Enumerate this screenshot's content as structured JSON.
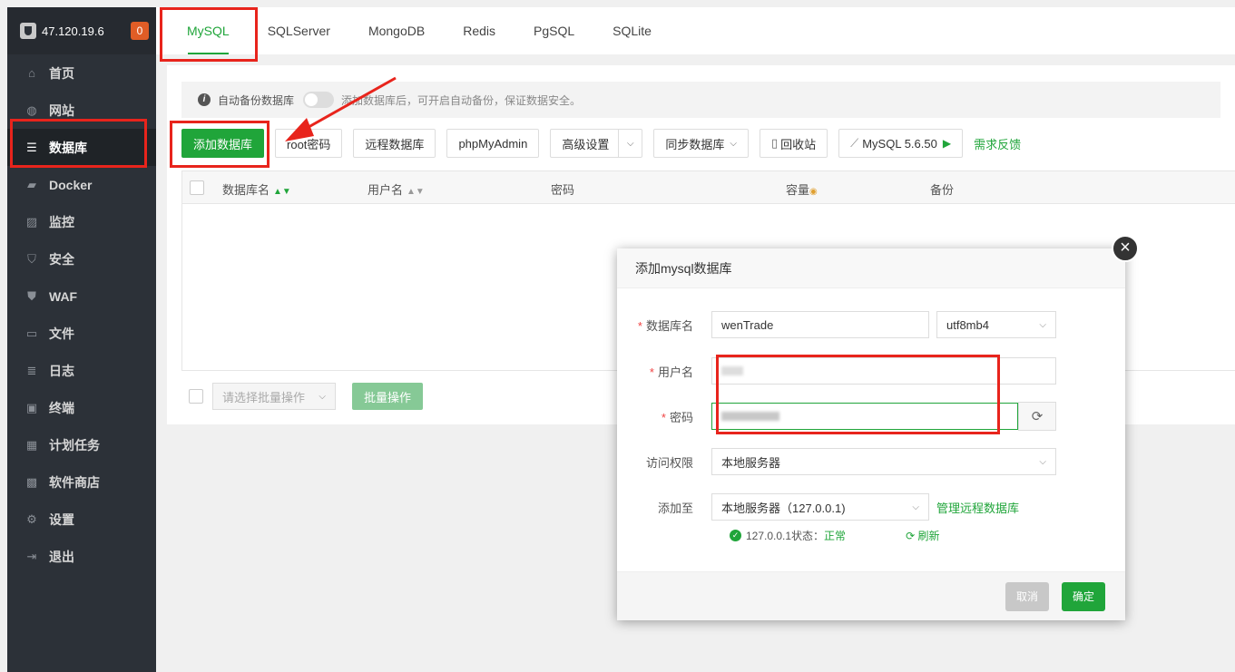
{
  "sidebar": {
    "server_ip": "47.120.19.6",
    "badge": "0",
    "items": [
      {
        "label": "首页",
        "icon": "home-icon",
        "glyph": "⌂"
      },
      {
        "label": "网站",
        "icon": "globe-icon",
        "glyph": "◍"
      },
      {
        "label": "数据库",
        "icon": "database-icon",
        "glyph": "☰"
      },
      {
        "label": "Docker",
        "icon": "docker-icon",
        "glyph": "▰"
      },
      {
        "label": "监控",
        "icon": "monitor-icon",
        "glyph": "▨"
      },
      {
        "label": "安全",
        "icon": "shield-icon",
        "glyph": "⛉"
      },
      {
        "label": "WAF",
        "icon": "waf-shield-icon",
        "glyph": "⛊"
      },
      {
        "label": "文件",
        "icon": "folder-icon",
        "glyph": "▭"
      },
      {
        "label": "日志",
        "icon": "log-icon",
        "glyph": "≣"
      },
      {
        "label": "终端",
        "icon": "terminal-icon",
        "glyph": "▣"
      },
      {
        "label": "计划任务",
        "icon": "calendar-icon",
        "glyph": "▦"
      },
      {
        "label": "软件商店",
        "icon": "apps-icon",
        "glyph": "▩"
      },
      {
        "label": "设置",
        "icon": "gear-icon",
        "glyph": "⚙"
      },
      {
        "label": "退出",
        "icon": "logout-icon",
        "glyph": "⇥"
      }
    ]
  },
  "tabs": [
    "MySQL",
    "SQLServer",
    "MongoDB",
    "Redis",
    "PgSQL",
    "SQLite"
  ],
  "notice": {
    "label": "自动备份数据库",
    "hint": "添加数据库后，可开启自动备份，保证数据安全。"
  },
  "toolbar": {
    "add_db": "添加数据库",
    "root_pwd": "root密码",
    "remote_db": "远程数据库",
    "phpmyadmin": "phpMyAdmin",
    "advanced": "高级设置",
    "sync_db": "同步数据库",
    "recycle": "回收站",
    "mysql_version": "MySQL 5.6.50",
    "feedback": "需求反馈"
  },
  "table": {
    "headers": [
      "数据库名",
      "用户名",
      "密码",
      "容量",
      "备份"
    ]
  },
  "bottom": {
    "batch_placeholder": "请选择批量操作",
    "batch_button": "批量操作"
  },
  "modal": {
    "title": "添加mysql数据库",
    "db_name_label": "数据库名",
    "db_name_value": "wenTrade",
    "charset": "utf8mb4",
    "username_label": "用户名",
    "password_label": "密码",
    "access_label": "访问权限",
    "access_value": "本地服务器",
    "add_to_label": "添加至",
    "add_to_value": "本地服务器（127.0.0.1)",
    "manage_remote": "管理远程数据库",
    "status_prefix": "127.0.0.1状态：",
    "status_value": "正常",
    "refresh": "刷新",
    "cancel": "取消",
    "confirm": "确定"
  },
  "colors": {
    "accent": "#20a53a",
    "annotation": "#e8241c",
    "sidebar_bg": "#2c3138"
  }
}
